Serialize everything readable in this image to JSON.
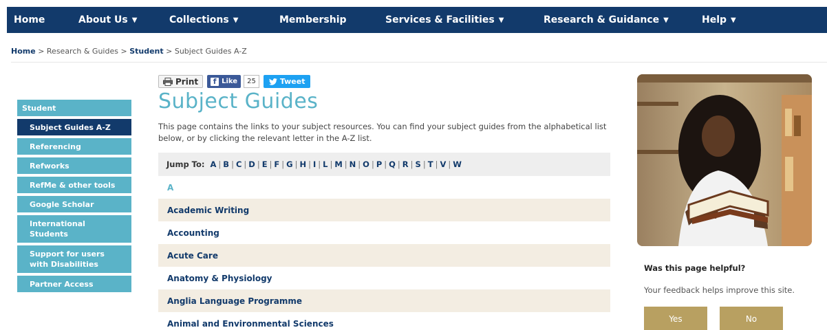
{
  "nav": [
    {
      "label": "Home",
      "caret": false
    },
    {
      "label": "About Us",
      "caret": true
    },
    {
      "label": "Collections",
      "caret": true
    },
    {
      "label": "Membership",
      "caret": false
    },
    {
      "label": "Services & Facilities",
      "caret": true
    },
    {
      "label": "Research & Guidance",
      "caret": true
    },
    {
      "label": "Help",
      "caret": true
    }
  ],
  "breadcrumb": {
    "home": "Home",
    "sep": ">",
    "research": "Research & Guides",
    "student": "Student",
    "current": "Subject Guides A-Z"
  },
  "sidebar": {
    "header": "Student",
    "items": [
      "Subject Guides A-Z",
      "Referencing",
      "Refworks",
      "RefMe & other tools",
      "Google Scholar",
      "International Students",
      "Support for users with Disabilities",
      "Partner Access"
    ]
  },
  "share": {
    "print": "Print",
    "like": "Like",
    "like_count": "25",
    "tweet": "Tweet"
  },
  "page_title": "Subject Guides",
  "intro": "This page contains the links to your subject resources. You can find your subject guides from the alphabetical list below, or by clicking the relevant letter in the A-Z list.",
  "jump": {
    "label": "Jump To:",
    "letters": [
      "A",
      "B",
      "C",
      "D",
      "E",
      "F",
      "G",
      "H",
      "I",
      "L",
      "M",
      "N",
      "O",
      "P",
      "Q",
      "R",
      "S",
      "T",
      "V",
      "W"
    ]
  },
  "current_letter": "A",
  "subjects": [
    "Academic Writing",
    "Accounting",
    "Acute Care",
    "Anatomy & Physiology",
    "Anglia Language Programme",
    "Animal and Environmental Sciences"
  ],
  "feedback": {
    "question": "Was this page helpful?",
    "sub": "Your feedback helps improve this site.",
    "yes": "Yes",
    "no": "No"
  },
  "colors": {
    "nav_bg": "#123a6b",
    "accent": "#5ab3c8",
    "row_alt": "#f3ede2",
    "button_gold": "#b8a061"
  }
}
